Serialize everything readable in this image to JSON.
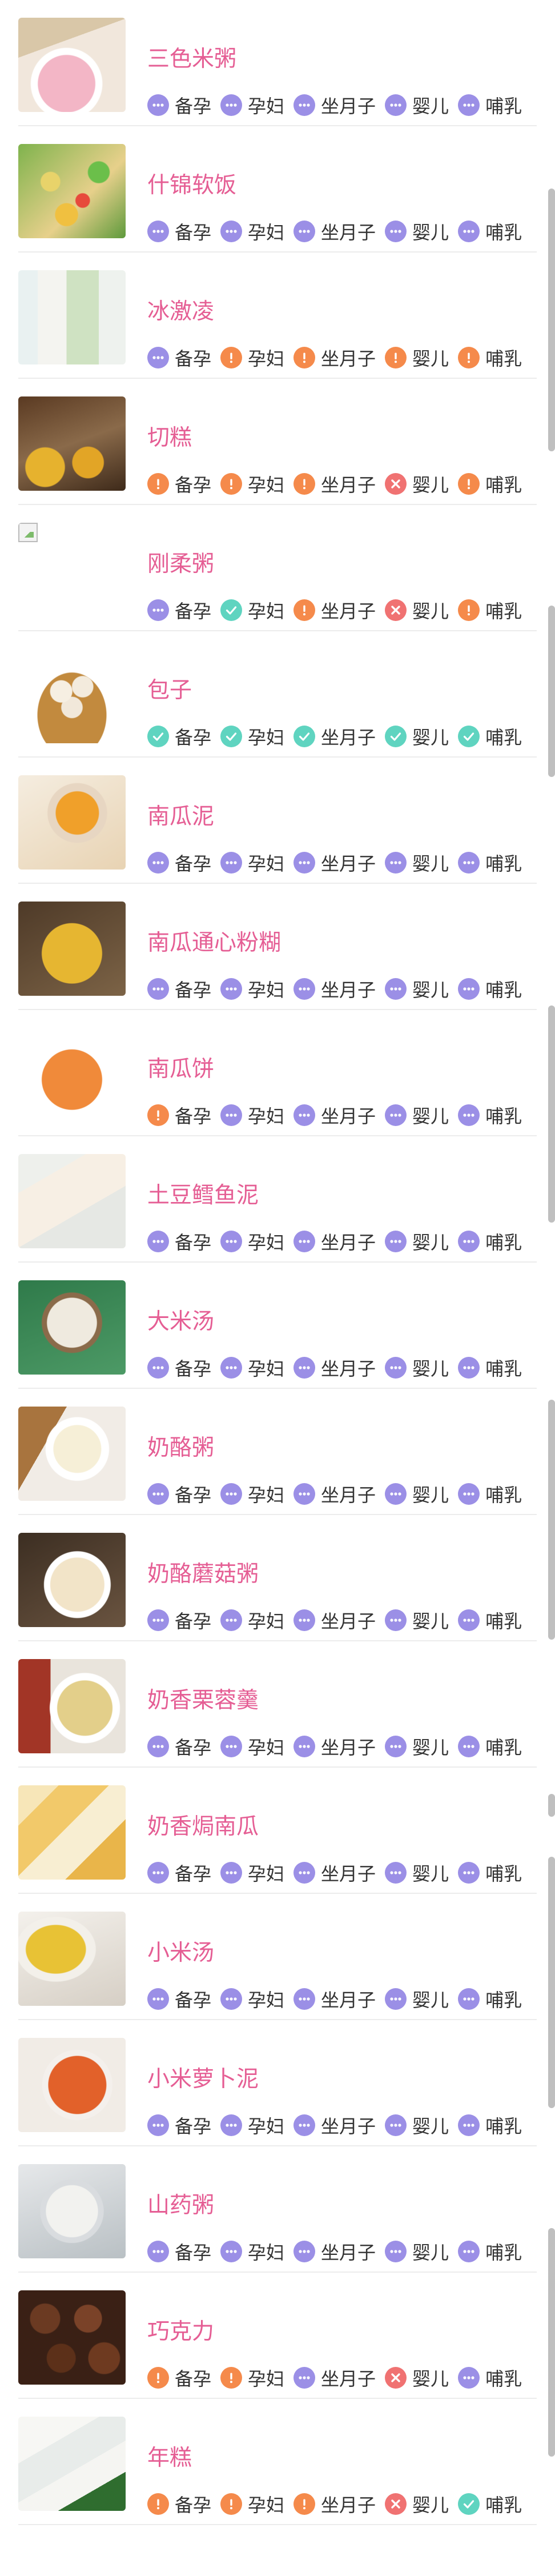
{
  "colors": {
    "title": "#e55e94",
    "tag_text": "#333333",
    "status": {
      "unknown": "#9b8fe6",
      "caution": "#f58a4b",
      "forbidden": "#f07272",
      "ok": "#5fd4c0"
    }
  },
  "tag_labels": [
    "备孕",
    "孕妇",
    "坐月子",
    "婴儿",
    "哺乳"
  ],
  "status_icons": {
    "unknown": "ellipsis-icon",
    "caution": "exclamation-icon",
    "forbidden": "cross-icon",
    "ok": "check-icon"
  },
  "items": [
    {
      "name": "三色米粥",
      "image": "pink-rice-porridge-photo",
      "statuses": [
        "unknown",
        "unknown",
        "unknown",
        "unknown",
        "unknown"
      ]
    },
    {
      "name": "什锦软饭",
      "image": "mixed-soft-rice-photo",
      "statuses": [
        "unknown",
        "unknown",
        "unknown",
        "unknown",
        "unknown"
      ]
    },
    {
      "name": "冰激凌",
      "image": "ice-cream-bar-photo",
      "statuses": [
        "unknown",
        "caution",
        "caution",
        "caution",
        "caution"
      ]
    },
    {
      "name": "切糕",
      "image": "nut-cake-photo",
      "statuses": [
        "caution",
        "caution",
        "caution",
        "forbidden",
        "caution"
      ]
    },
    {
      "name": "刚柔粥",
      "image": "broken-image",
      "statuses": [
        "unknown",
        "ok",
        "caution",
        "forbidden",
        "caution"
      ]
    },
    {
      "name": "包子",
      "image": "steamed-buns-photo",
      "statuses": [
        "ok",
        "ok",
        "ok",
        "ok",
        "ok"
      ]
    },
    {
      "name": "南瓜泥",
      "image": "pumpkin-puree-photo",
      "statuses": [
        "unknown",
        "unknown",
        "unknown",
        "unknown",
        "unknown"
      ]
    },
    {
      "name": "南瓜通心粉糊",
      "image": "pumpkin-macaroni-photo",
      "statuses": [
        "unknown",
        "unknown",
        "unknown",
        "unknown",
        "unknown"
      ]
    },
    {
      "name": "南瓜饼",
      "image": "pumpkin-pancake-photo",
      "statuses": [
        "caution",
        "unknown",
        "unknown",
        "unknown",
        "unknown"
      ]
    },
    {
      "name": "土豆鳕鱼泥",
      "image": "potato-cod-puree-photo",
      "statuses": [
        "unknown",
        "unknown",
        "unknown",
        "unknown",
        "unknown"
      ]
    },
    {
      "name": "大米汤",
      "image": "rice-soup-photo",
      "statuses": [
        "unknown",
        "unknown",
        "unknown",
        "unknown",
        "unknown"
      ]
    },
    {
      "name": "奶酪粥",
      "image": "cheese-porridge-photo",
      "statuses": [
        "unknown",
        "unknown",
        "unknown",
        "unknown",
        "unknown"
      ]
    },
    {
      "name": "奶酪蘑菇粥",
      "image": "cheese-mushroom-porridge-photo",
      "statuses": [
        "unknown",
        "unknown",
        "unknown",
        "unknown",
        "unknown"
      ]
    },
    {
      "name": "奶香栗蓉羹",
      "image": "chestnut-soup-photo",
      "statuses": [
        "unknown",
        "unknown",
        "unknown",
        "unknown",
        "unknown"
      ]
    },
    {
      "name": "奶香焗南瓜",
      "image": "baked-pumpkin-photo",
      "statuses": [
        "unknown",
        "unknown",
        "unknown",
        "unknown",
        "unknown"
      ]
    },
    {
      "name": "小米汤",
      "image": "millet-soup-photo",
      "statuses": [
        "unknown",
        "unknown",
        "unknown",
        "unknown",
        "unknown"
      ]
    },
    {
      "name": "小米萝卜泥",
      "image": "millet-carrot-puree-photo",
      "statuses": [
        "unknown",
        "unknown",
        "unknown",
        "unknown",
        "unknown"
      ]
    },
    {
      "name": "山药粥",
      "image": "yam-porridge-photo",
      "statuses": [
        "unknown",
        "unknown",
        "unknown",
        "unknown",
        "unknown"
      ]
    },
    {
      "name": "巧克力",
      "image": "chocolate-photo",
      "statuses": [
        "caution",
        "caution",
        "unknown",
        "forbidden",
        "unknown"
      ]
    },
    {
      "name": "年糕",
      "image": "rice-cake-photo",
      "statuses": [
        "caution",
        "caution",
        "caution",
        "forbidden",
        "ok"
      ]
    }
  ]
}
